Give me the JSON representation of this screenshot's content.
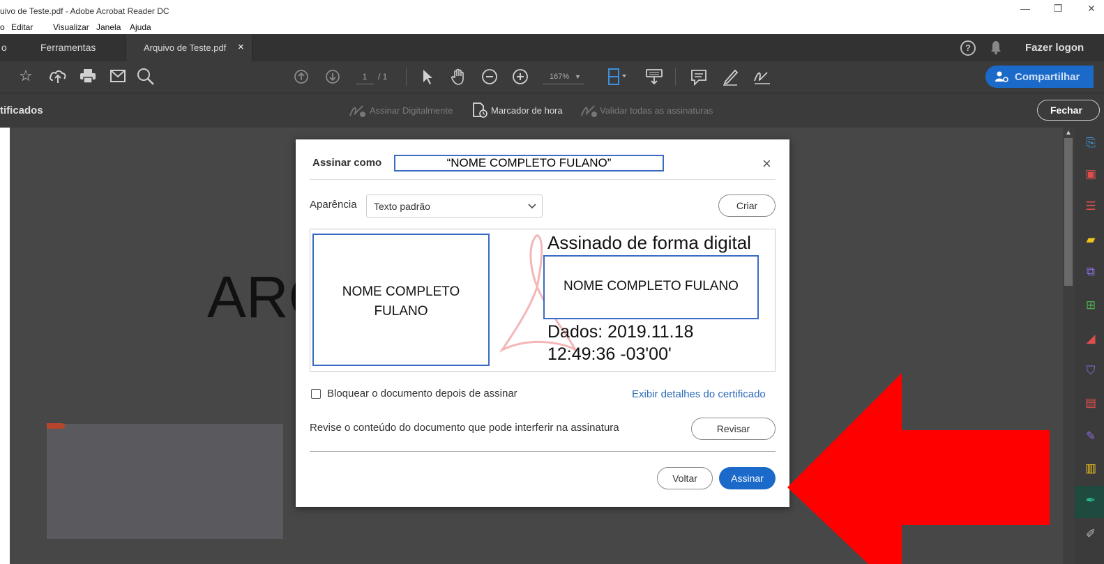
{
  "window": {
    "title": "uivo de Teste.pdf - Adobe Acrobat Reader DC",
    "min": "—",
    "restore": "❐",
    "close": "✕"
  },
  "menu": [
    "o",
    "Editar",
    "Visualizar",
    "Janela",
    "Ajuda"
  ],
  "tabs": {
    "home": "o",
    "tools": "Ferramentas",
    "document": "Arquivo de Teste.pdf",
    "close_tab": "×",
    "help": "?",
    "login": "Fazer logon"
  },
  "toolbar": {
    "page_current": "1",
    "page_total": "/ 1",
    "zoom": "167%",
    "share": "Compartilhar"
  },
  "certbar": {
    "title": "tificados",
    "sign_digitally": "Assinar Digitalmente",
    "timestamp": "Marcador de hora",
    "validate_all": "Validar todas as assinaturas",
    "close": "Fechar"
  },
  "document": {
    "big_text": "ARQ"
  },
  "dialog": {
    "sign_as_label": "Assinar como",
    "signer_name": "“NOME COMPLETO FULANO”",
    "close": "×",
    "appearance_label": "Aparência",
    "appearance_value": "Texto padrão",
    "create_button": "Criar",
    "preview": {
      "left_name": "NOME COMPLETO FULANO",
      "signed_text": "Assinado de forma digital",
      "right_name": "NOME COMPLETO FULANO",
      "date_line1": "Dados: 2019.11.18",
      "date_line2": "12:49:36 -03'00'"
    },
    "lock_checkbox_label": "Bloquear o documento depois de assinar",
    "cert_details_link": "Exibir detalhes do certificado",
    "review_text": "Revise o conteúdo do documento que pode interferir na assinatura",
    "review_button": "Revisar",
    "back_button": "Voltar",
    "sign_button": "Assinar"
  },
  "colors": {
    "accent_blue": "#1b6ac9",
    "link_blue": "#2d6bb8",
    "annotation_blue": "#3a6bc4",
    "arrow_red": "#ff0000",
    "toolbar_dark": "#3b3b3b",
    "doc_gray": "#474747"
  }
}
